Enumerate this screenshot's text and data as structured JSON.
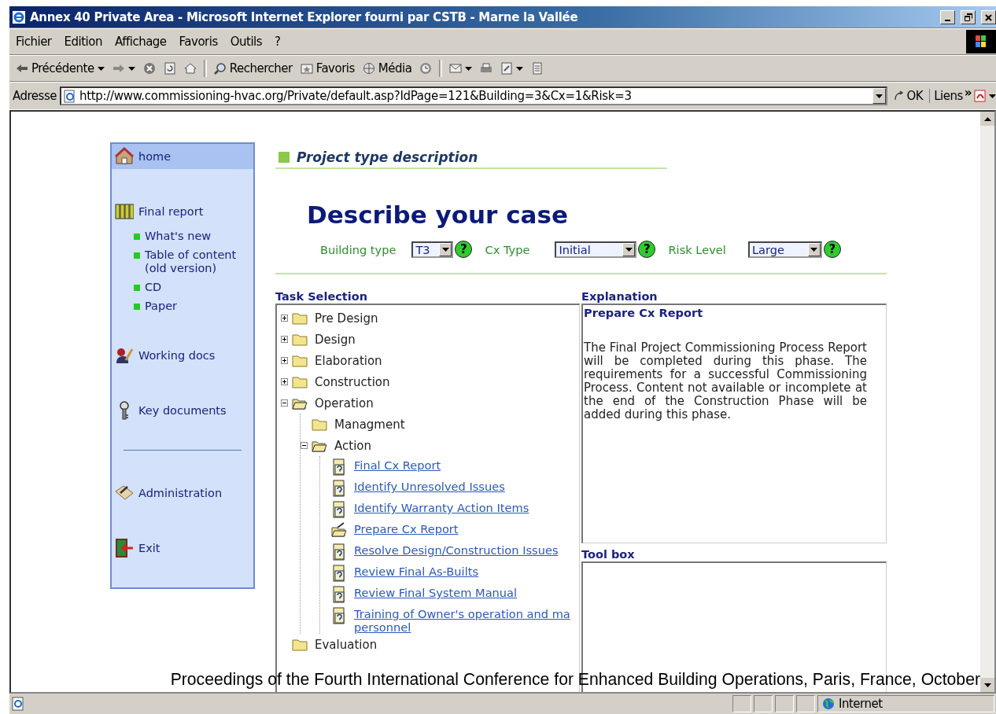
{
  "window": {
    "title": "Annex 40 Private Area - Microsoft Internet Explorer fourni par CSTB - Marne la Vallée"
  },
  "menu": [
    "Fichier",
    "Edition",
    "Affichage",
    "Favoris",
    "Outils",
    "?"
  ],
  "toolbar": [
    {
      "kind": "back",
      "label": "Précédente",
      "menu": true
    },
    {
      "kind": "forward",
      "menu": true
    },
    {
      "kind": "stop",
      "menu": false
    },
    {
      "kind": "refresh",
      "menu": false
    },
    {
      "kind": "home",
      "menu": false
    },
    {
      "kind": "separator"
    },
    {
      "kind": "search",
      "label": "Rechercher",
      "menu": false
    },
    {
      "kind": "favorites",
      "label": "Favoris",
      "menu": false
    },
    {
      "kind": "media",
      "label": "Média",
      "menu": false
    },
    {
      "kind": "history",
      "menu": false
    },
    {
      "kind": "separator"
    },
    {
      "kind": "mail",
      "menu": true
    },
    {
      "kind": "print",
      "menu": false
    },
    {
      "kind": "edit",
      "menu": true
    },
    {
      "kind": "discuss",
      "menu": false
    }
  ],
  "address": {
    "label": "Adresse",
    "value": "http://www.commissioning-hvac.org/Private/default.asp?IdPage=121&Building=3&Cx=1&Risk=3",
    "go": "OK",
    "links": "Liens",
    "more": "»"
  },
  "sidebar": {
    "items": [
      {
        "kind": "main",
        "label": "home",
        "selected": true
      },
      {
        "kind": "main",
        "label": "Final report",
        "selected": false
      },
      {
        "kind": "sub",
        "label": "What's new",
        "selected": false
      },
      {
        "kind": "sub",
        "label": "Table of content (old version)",
        "selected": false
      },
      {
        "kind": "sub",
        "label": "CD",
        "selected": false
      },
      {
        "kind": "sub",
        "label": "Paper",
        "selected": false
      },
      {
        "kind": "main",
        "label": "Working docs",
        "selected": false
      },
      {
        "kind": "main",
        "label": "Key documents",
        "selected": false
      },
      {
        "kind": "divider"
      },
      {
        "kind": "main",
        "label": "Administration",
        "selected": false
      },
      {
        "kind": "main",
        "label": "Exit",
        "selected": false
      }
    ]
  },
  "section_title": "Project type description",
  "heading": "Describe your case",
  "selectors": [
    {
      "label": "Building type",
      "value": "T3",
      "help": "?"
    },
    {
      "label": "Cx Type",
      "value": "Initial",
      "help": "?"
    },
    {
      "label": "Risk Level",
      "value": "Large",
      "help": "?"
    }
  ],
  "task_selection": {
    "title": "Task Selection",
    "tree": [
      {
        "kind": "group",
        "label": "Pre Design",
        "expanded": false
      },
      {
        "kind": "group",
        "label": "Design",
        "expanded": false
      },
      {
        "kind": "group",
        "label": "Elaboration",
        "expanded": false
      },
      {
        "kind": "group",
        "label": "Construction",
        "expanded": false
      },
      {
        "kind": "group",
        "label": "Operation",
        "expanded": true,
        "children": [
          {
            "kind": "folder",
            "label": "Managment"
          },
          {
            "kind": "group",
            "label": "Action",
            "expanded": true,
            "children": [
              {
                "kind": "task",
                "lines": [
                  "Final Cx Report"
                ],
                "selected": false
              },
              {
                "kind": "task",
                "lines": [
                  "Identify Unresolved Issues"
                ],
                "selected": false
              },
              {
                "kind": "task",
                "lines": [
                  "Identify Warranty Action Items"
                ],
                "selected": false
              },
              {
                "kind": "task",
                "lines": [
                  "Prepare Cx Report"
                ],
                "selected": true
              },
              {
                "kind": "task",
                "lines": [
                  "Resolve Design/Construction Issues"
                ],
                "selected": false
              },
              {
                "kind": "task",
                "lines": [
                  "Review Final As-Builts"
                ],
                "selected": false
              },
              {
                "kind": "task",
                "lines": [
                  "Review Final System Manual"
                ],
                "selected": false
              },
              {
                "kind": "task",
                "lines": [
                  "Training of Owner's operation and ma",
                  "personnel"
                ],
                "selected": false
              }
            ]
          }
        ]
      },
      {
        "kind": "folder",
        "label": "Evaluation"
      }
    ]
  },
  "explanation": {
    "title": "Explanation",
    "heading": "Prepare Cx Report",
    "text": "The Final Project Commissioning Process Report will be completed during this phase. The requirements for a successful Commissioning Process. Content not available or incomplete at the end of the Construction Phase will be added during this phase."
  },
  "tool_box": {
    "title": "Tool box"
  },
  "caption": "Proceedings of the Fourth International Conference for Enhanced Building Operations, Paris, France, October",
  "status_bar": {
    "zone": "Internet"
  }
}
